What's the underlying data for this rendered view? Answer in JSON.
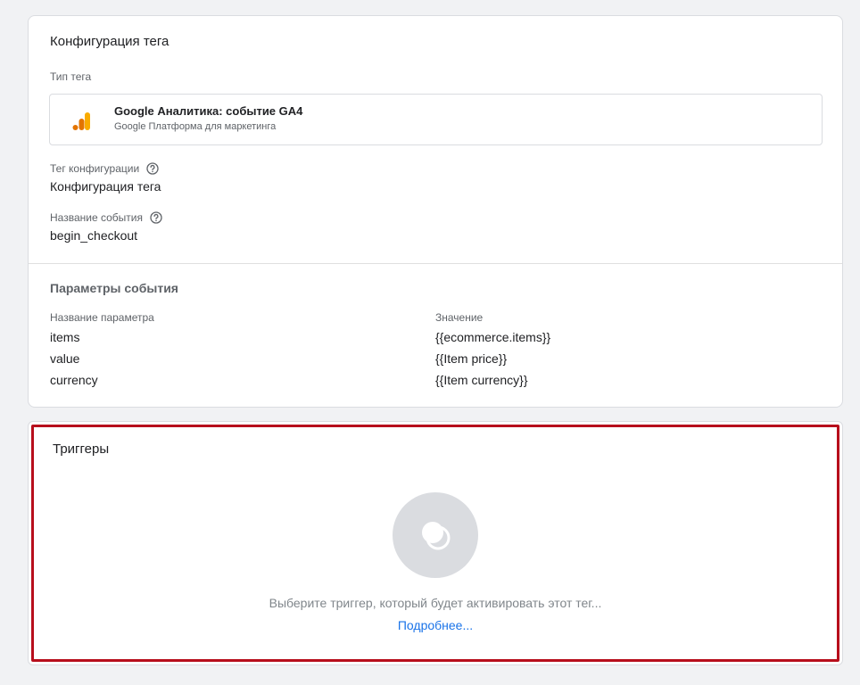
{
  "config": {
    "title": "Конфигурация тега",
    "tag_type_label": "Тип тега",
    "tag_type": {
      "name": "Google Аналитика: событие GA4",
      "subtitle": "Google Платформа для маркетинга",
      "icon": "google-analytics-icon"
    },
    "config_tag_label": "Тег конфигурации",
    "config_tag_value": "Конфигурация тега",
    "event_name_label": "Название события",
    "event_name_value": "begin_checkout",
    "params_title": "Параметры события",
    "params_headers": {
      "name": "Название параметра",
      "value": "Значение"
    },
    "params": [
      {
        "name": "items",
        "value": "{{ecommerce.items}}"
      },
      {
        "name": "value",
        "value": "{{Item price}}"
      },
      {
        "name": "currency",
        "value": "{{Item currency}}"
      }
    ]
  },
  "triggers": {
    "title": "Триггеры",
    "hint": "Выберите триггер, который будет активировать этот тег...",
    "link": "Подробнее...",
    "icon": "trigger-icon"
  },
  "colors": {
    "accent_link": "#1a73e8",
    "highlight_border": "#b70e1c",
    "ga_orange": "#f9ab00",
    "ga_dark_orange": "#e37400"
  }
}
